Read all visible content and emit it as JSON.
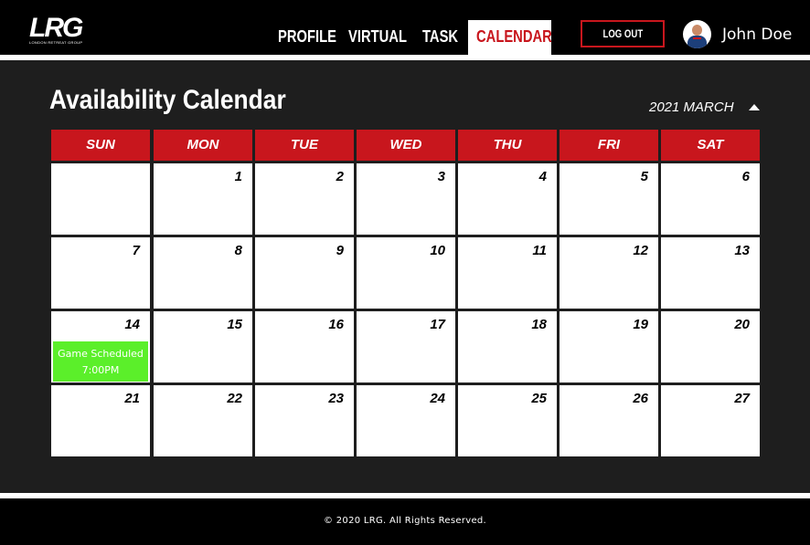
{
  "header": {
    "logo_text": "LRG",
    "logo_subtext": "LONDON RETREAT GROUP",
    "nav": {
      "profile": "PROFILE",
      "virtual": "VIRTUAL",
      "task": "TASK",
      "calendar": "CALENDAR"
    },
    "active_nav": "CALENDAR",
    "logout_label": "LOG OUT",
    "user_name": "John Doe"
  },
  "page": {
    "title": "Availability Calendar",
    "month_label": "2021 MARCH"
  },
  "calendar": {
    "days_of_week": [
      "SUN",
      "MON",
      "TUE",
      "WED",
      "THU",
      "FRI",
      "SAT"
    ],
    "weeks": [
      [
        "",
        "1",
        "2",
        "3",
        "4",
        "5",
        "6"
      ],
      [
        "7",
        "8",
        "9",
        "10",
        "11",
        "12",
        "13"
      ],
      [
        "14",
        "15",
        "16",
        "17",
        "18",
        "19",
        "20"
      ],
      [
        "21",
        "22",
        "23",
        "24",
        "25",
        "26",
        "27"
      ]
    ],
    "event": {
      "day": "14",
      "title": "Game Scheduled",
      "time": "7:00PM"
    }
  },
  "footer": {
    "copyright": "© 2020 LRG.  All Rights Reserved."
  },
  "colors": {
    "accent_red": "#c8161d",
    "event_green": "#5bef2a",
    "background": "#1e1e1e",
    "header_bg": "#000000"
  }
}
